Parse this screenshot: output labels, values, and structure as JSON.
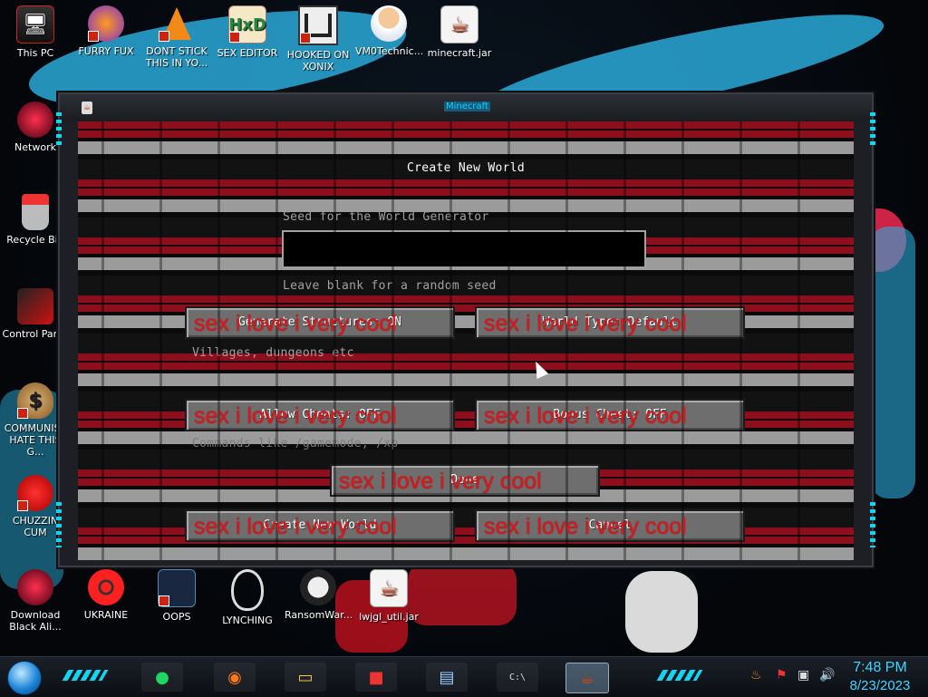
{
  "window": {
    "title": "Minecraft"
  },
  "screen": {
    "title": "Create New World",
    "seed_label": "Seed for the World Generator",
    "seed_value": "",
    "seed_hint": "Leave blank for a random seed",
    "structures_hint": "Villages, dungeons etc",
    "cheats_hint": "Commands like /gamemode, /xp"
  },
  "buttons": {
    "generate_structures": "Generate Structures: ON",
    "world_type": "World Type: Default",
    "allow_cheats": "Allow Cheats: OFF",
    "bonus_chest": "Bonus Chest: OFF",
    "done": "Done",
    "create_world": "Create New World",
    "cancel": "Cancel"
  },
  "graffiti": "sex i love i very cool",
  "desktop_icons": {
    "this_pc": "This PC",
    "furry_fux": "FURRY FUX",
    "dont_stick": "DONT STICK THIS IN YO...",
    "sex_editor": "SEX EDITOR",
    "hooked_xonix": "HOOKED ON XONIX",
    "vm0": "VM0Technic...",
    "minecraft_jar": "minecraft.jar",
    "network": "Network",
    "recycle_bin": "Recycle Bin",
    "control_panel": "Control Panel",
    "communist": "COMMUNIST HATE THIS G...",
    "chuzzin": "CHUZZIN CUM",
    "download_black": "Download Black Ali...",
    "ukraine": "UKRAINE",
    "oops": "OOPS",
    "lynching": "LYNCHING",
    "ransomware": "RansomWar...",
    "lwjgl": "lwjgl_util.jar"
  },
  "taskbar": {
    "time": "7:48 PM",
    "date": "8/23/2023"
  },
  "colors": {
    "minecraft_bg_red": "#8b0f1c",
    "graffiti_red": "#e0161b",
    "accent_cyan": "#15d4f0",
    "window_title": "#00d8ff"
  }
}
